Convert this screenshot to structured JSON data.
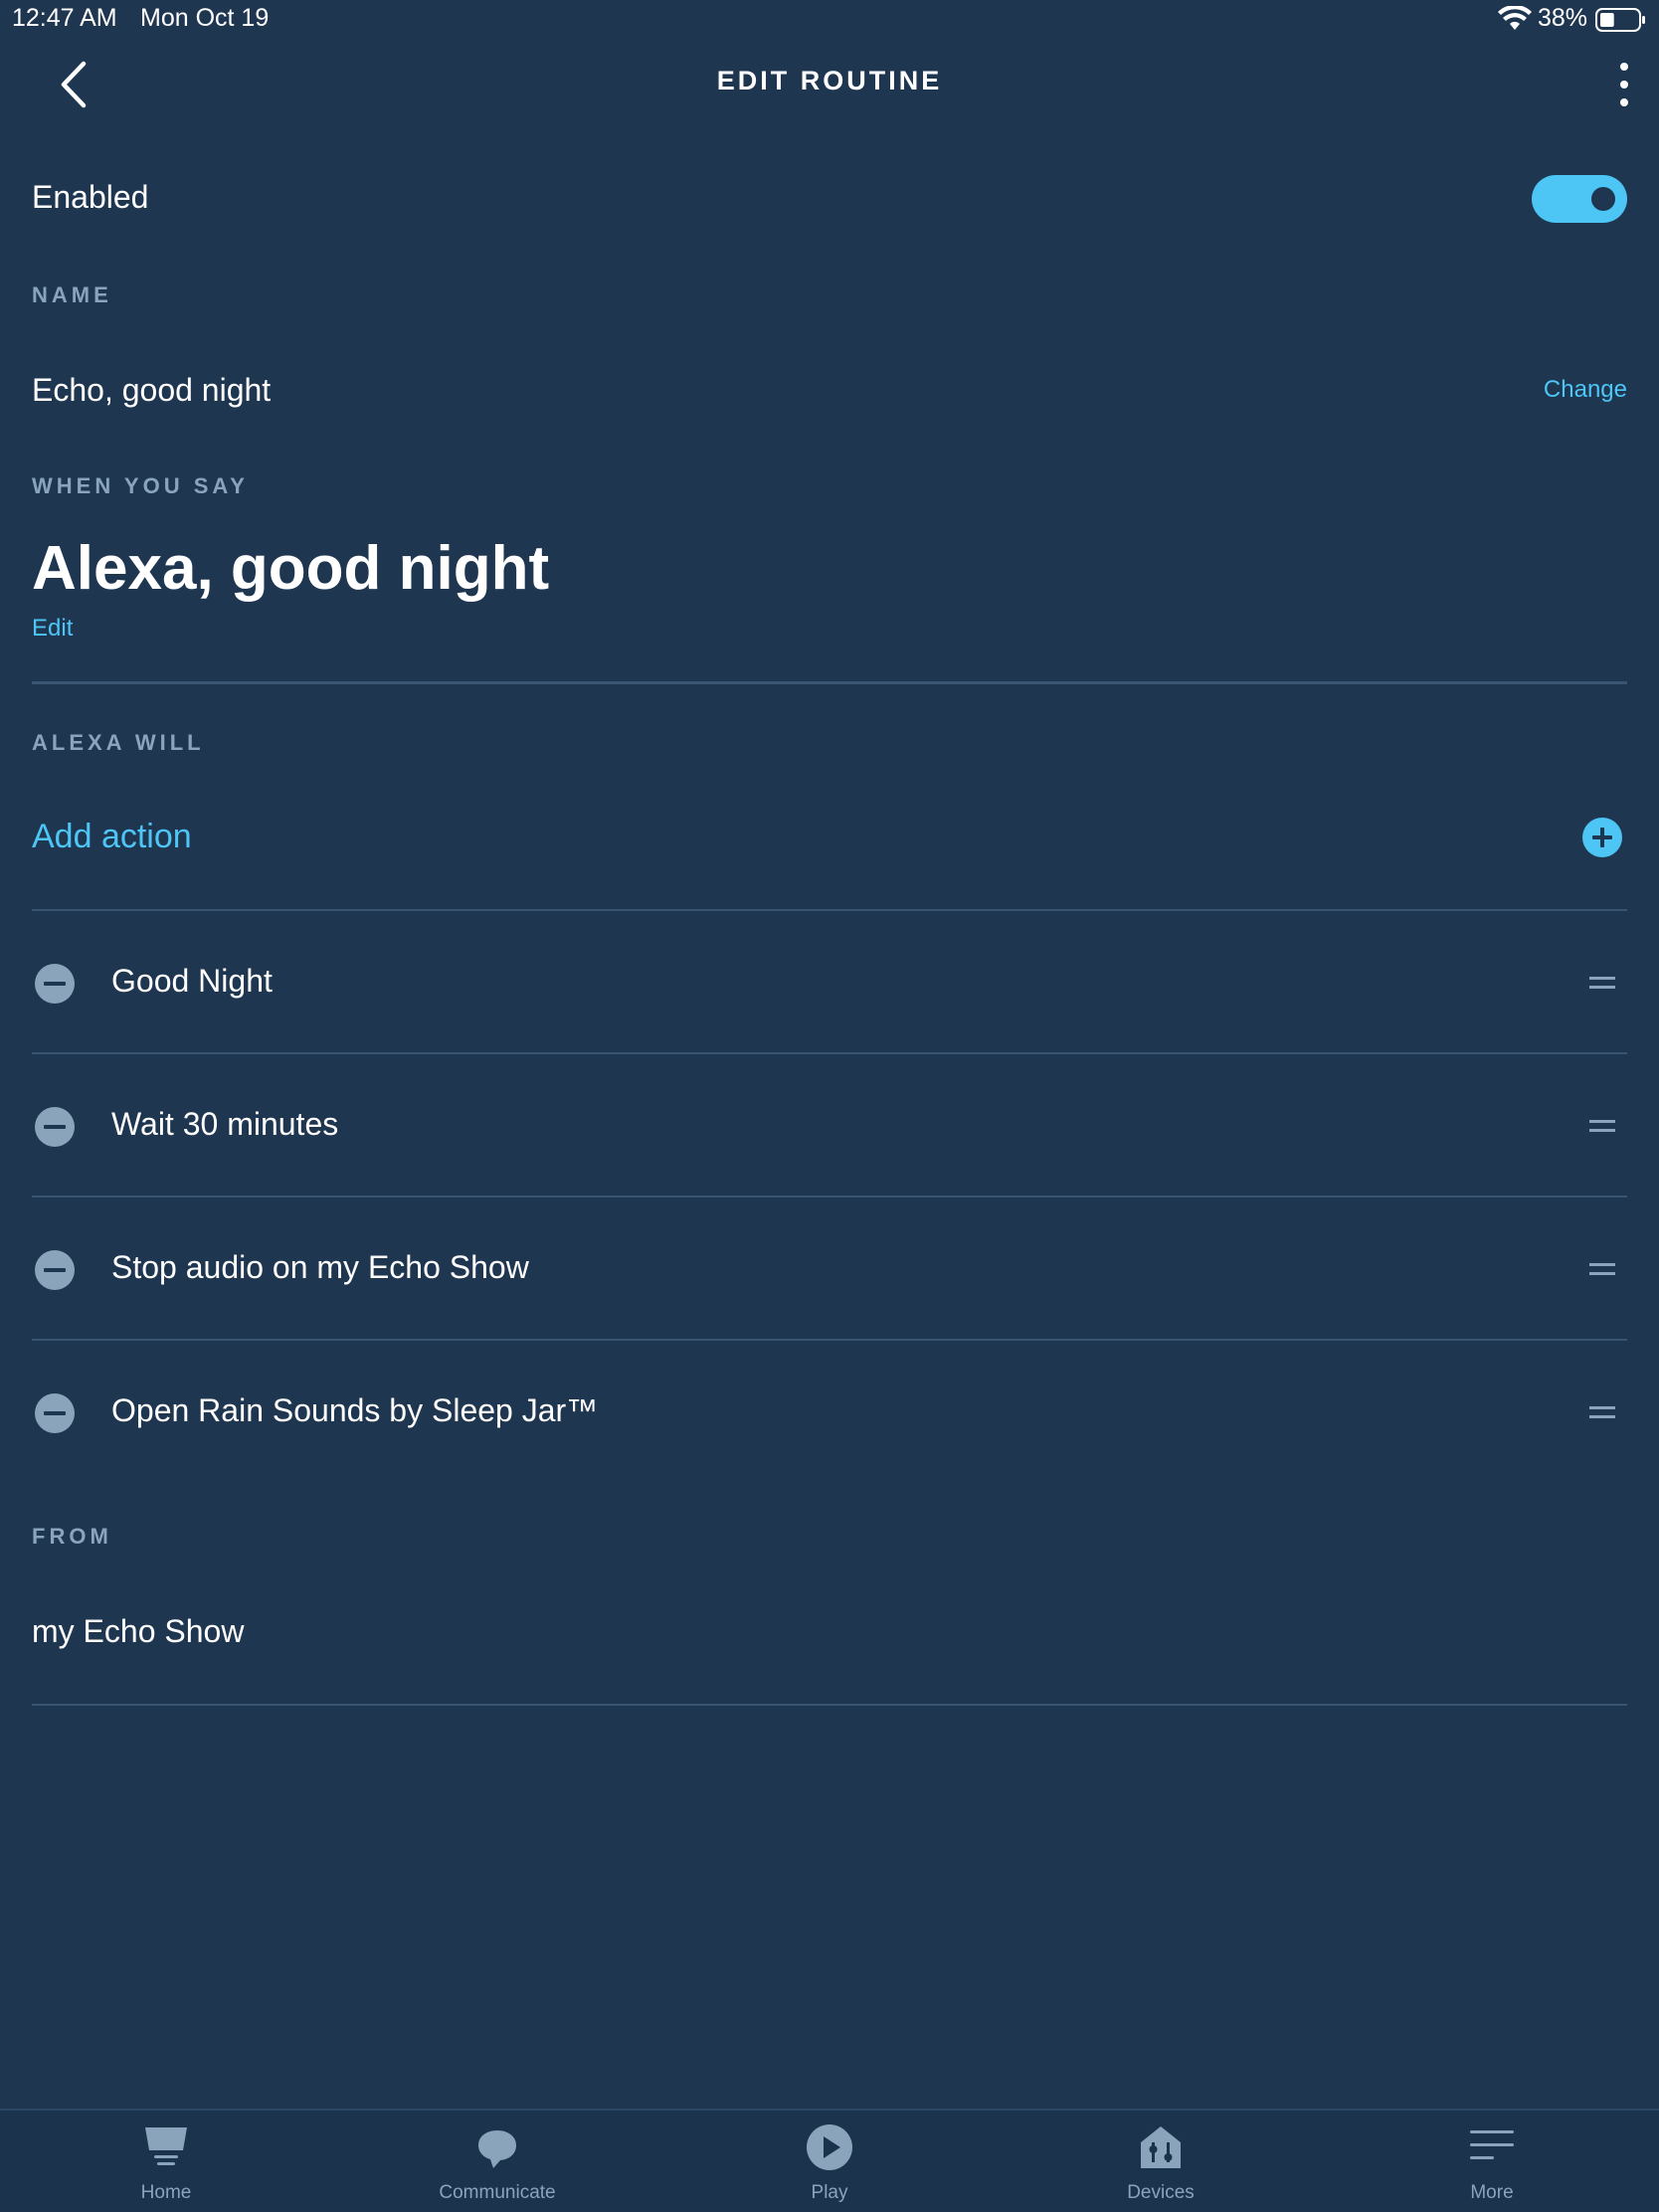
{
  "status_bar": {
    "time": "12:47 AM",
    "date": "Mon Oct 19",
    "battery_percent": "38%",
    "battery_level": 0.38
  },
  "header": {
    "title": "EDIT ROUTINE",
    "back_icon": "chevron-left-icon",
    "more_icon": "more-vertical-icon"
  },
  "enabled": {
    "label": "Enabled",
    "value": true
  },
  "name_section": {
    "label": "NAME",
    "value": "Echo, good night",
    "change_label": "Change"
  },
  "when_section": {
    "label": "WHEN YOU SAY",
    "phrase": "Alexa, good night",
    "edit_label": "Edit"
  },
  "actions_section": {
    "label": "ALEXA WILL",
    "add_label": "Add action",
    "items": [
      {
        "label": "Good Night"
      },
      {
        "label": "Wait 30 minutes"
      },
      {
        "label": "Stop audio on my Echo Show"
      },
      {
        "label": "Open Rain Sounds by Sleep Jar™"
      }
    ]
  },
  "from_section": {
    "label": "FROM",
    "value": "my Echo Show"
  },
  "bottom_nav": {
    "items": [
      {
        "label": "Home",
        "icon": "home-icon"
      },
      {
        "label": "Communicate",
        "icon": "chat-bubble-icon"
      },
      {
        "label": "Play",
        "icon": "play-icon"
      },
      {
        "label": "Devices",
        "icon": "devices-icon"
      },
      {
        "label": "More",
        "icon": "menu-lines-icon"
      }
    ]
  },
  "colors": {
    "background": "#1f3651",
    "accent": "#4dc5f5",
    "muted": "#8aa4bc",
    "divider": "#3a5572"
  }
}
